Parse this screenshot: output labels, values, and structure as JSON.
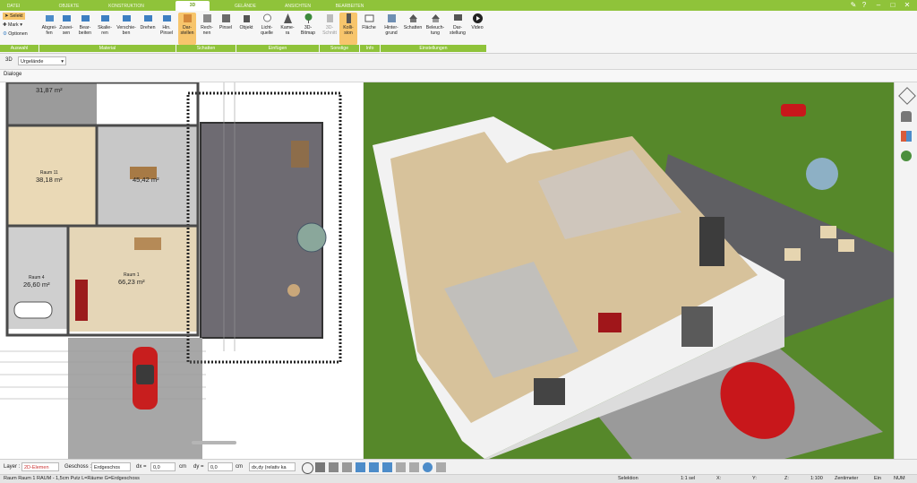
{
  "tabs": [
    "DATEI",
    "OBJEKTE",
    "KONSTRUKTION",
    "3D",
    "GELÄNDE",
    "ANSICHTEN",
    "BEARBEITEN"
  ],
  "active_tab": "3D",
  "left_tools": {
    "select": "Selekt",
    "mark": "Mark",
    "options": "Optionen",
    "group": "Auswahl"
  },
  "ribbon": {
    "material": {
      "group": "Material",
      "buttons": [
        "Abgrei-\nfen",
        "Zuwei-\nsen",
        "Bear-\nbeiten",
        "Skalie-\nren",
        "Verschie-\nben",
        "Drehen",
        "Hin.\nPinsel"
      ]
    },
    "schatten": {
      "group": "Schatten",
      "buttons": [
        "Dar-\nstellen",
        "Rech-\nnen",
        "Pinsel"
      ]
    },
    "einfuegen": {
      "group": "Einfügen",
      "buttons": [
        "Objekt",
        "Licht-\nquelle",
        "Kame-\nra",
        "3D-\nBitmap"
      ]
    },
    "sonstige": {
      "group": "Sonstige",
      "buttons": [
        "3D-\nSchnitt",
        "Kolli-\nsion"
      ]
    },
    "info": {
      "group": "Info",
      "buttons": [
        "Fläche"
      ]
    },
    "einstellungen": {
      "group": "Einstellungen",
      "buttons": [
        "Hinter-\ngrund",
        "Schatten",
        "Beleuch-\ntung",
        "Dar-\nstellung",
        "Video"
      ]
    }
  },
  "subbar": {
    "view": "3D",
    "terrain": "Urgelände"
  },
  "dialog_label": "Dialoge",
  "rooms": [
    {
      "name": "",
      "area": "31,87 m²"
    },
    {
      "name": "Raum 11",
      "area": "38,18 m²"
    },
    {
      "name": "",
      "area": "45,42 m²"
    },
    {
      "name": "Raum 4",
      "area": "26,60 m²"
    },
    {
      "name": "Raum 1",
      "area": "66,23 m²"
    }
  ],
  "bottom": {
    "layer_label": "Layer :",
    "layer_value": "2D-Elemen",
    "floor_label": "Geschoss :",
    "floor_value": "Erdgeschos",
    "dx_label": "dx =",
    "dx_value": "0,0",
    "dx_unit": "cm",
    "dy_label": "dy =",
    "dy_value": "0,0",
    "dy_unit": "cm",
    "mode_value": "dx,dy (relativ ka"
  },
  "status": {
    "left": "Raum Raum 1 RAUM - 1,5cm Putz L=Räume G=Erdgeschoss",
    "sel": "Selektion",
    "scale": "1:1 sel",
    "x": "X:",
    "y": "Y:",
    "z": "Z:",
    "zoom": "1:100",
    "unit": "Zentimeter",
    "ein": "Ein",
    "num": "NUM"
  },
  "colors": {
    "accent": "#8fc33a",
    "highlight": "#f7c56c",
    "grass": "#5a8a2a",
    "deck": "#5f5f63"
  }
}
